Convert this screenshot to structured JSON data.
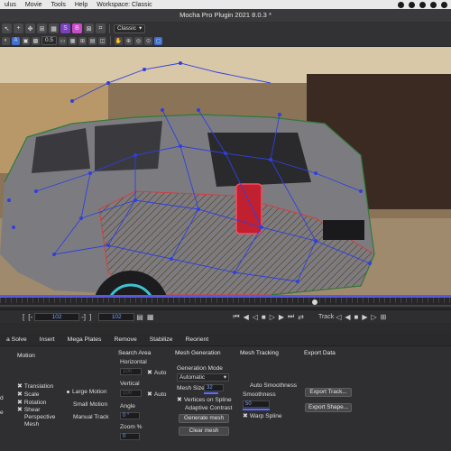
{
  "menubar": {
    "items": [
      "ulus",
      "Movie",
      "Tools",
      "Help",
      "Workspace: Classic"
    ]
  },
  "window": {
    "title": "Mocha Pro Plugin 2021 8.0.3 *"
  },
  "toolbar": {
    "view_preset": "Classic",
    "zoom_value": "0.5"
  },
  "timeline": {
    "in_frame": "102",
    "out_frame": "102",
    "track_label": "Track"
  },
  "tabs": [
    "a Solve",
    "Insert",
    "Mega Plates",
    "Remove",
    "Stabilize",
    "Reorient"
  ],
  "panel": {
    "motion": {
      "header": "Motion",
      "translation": "Translation",
      "scale": "Scale",
      "rotation": "Rotation",
      "shear": "Shear",
      "perspective": "Perspective",
      "mesh": "Mesh",
      "left_clip_1": "d",
      "left_clip_2": "e"
    },
    "motion_size": {
      "large": "Large Motion",
      "small": "Small Motion",
      "manual": "Manual Track"
    },
    "search_area": {
      "header": "Search Area",
      "horizontal": "Horizontal",
      "horizontal_value": "100",
      "auto": "Auto",
      "vertical": "Vertical",
      "vertical_value": "100",
      "angle": "Angle",
      "angle_value": "0 °",
      "zoom": "Zoom %",
      "zoom_value": "0"
    },
    "mesh_generation": {
      "header": "Mesh Generation",
      "mode_label": "Generation Mode",
      "mode_value": "Automatic",
      "mesh_size_label": "Mesh Size",
      "mesh_size_value": "32",
      "vertices_on_spline": "Vertices on Spline",
      "adaptive_contrast": "Adaptive Contrast",
      "generate_button": "Generate mesh",
      "clear_button": "Clear mesh"
    },
    "mesh_tracking": {
      "header": "Mesh Tracking",
      "auto_smoothness": "Auto Smoothness",
      "smoothness_label": "Smoothness",
      "smoothness_value": "50",
      "warp_spline": "Warp Spline"
    },
    "export": {
      "header": "Export Data",
      "track_button": "Export Track...",
      "shape_button": "Export Shape..."
    }
  },
  "colors": {
    "accent": "#5b6cff",
    "mesh_line": "#2f3fe0",
    "spline_outline": "#d04040",
    "tracked_region": "#7a5a3a"
  }
}
